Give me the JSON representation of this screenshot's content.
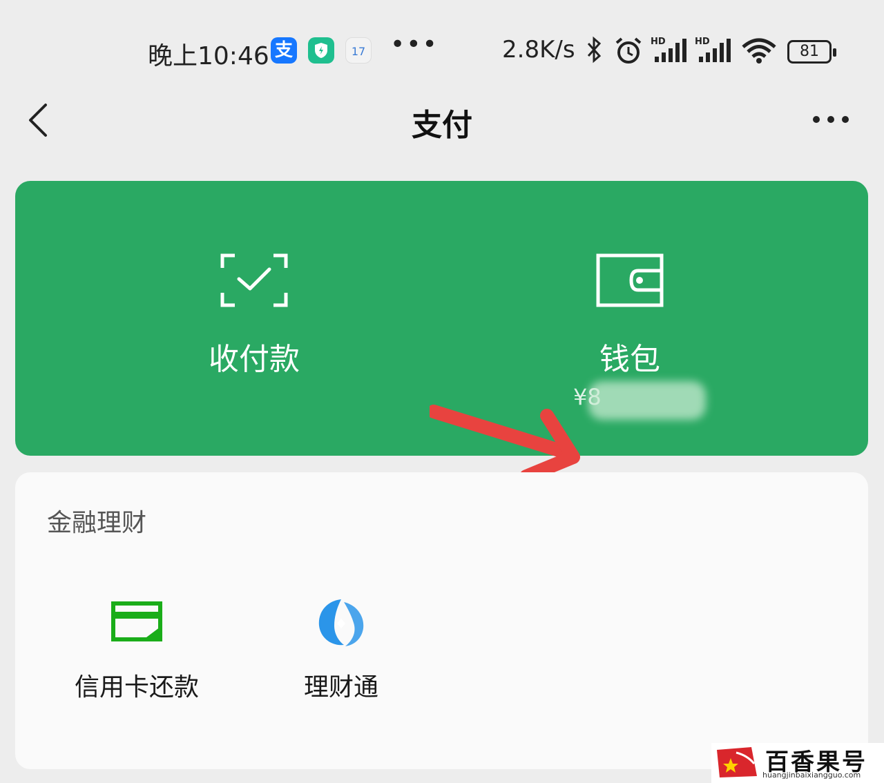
{
  "status_bar": {
    "time": "晚上10:46",
    "alipay_glyph": "支",
    "calendar_day": "17",
    "more_dots": "•••",
    "net_speed": "2.8K/s",
    "battery": "81",
    "icons": [
      "alipay-icon",
      "shield-icon",
      "calendar-icon",
      "bluetooth-icon",
      "alarm-icon",
      "signal-hd-icon",
      "signal-hd-icon",
      "wifi-icon",
      "battery-icon"
    ]
  },
  "nav": {
    "title": "支付",
    "back_icon": "chevron-left-icon",
    "more_icon": "more-dots-icon"
  },
  "green_card": {
    "color": "#2aa963",
    "pay": {
      "label": "收付款",
      "icon": "scan-check-icon"
    },
    "wallet": {
      "label": "钱包",
      "icon": "wallet-icon",
      "balance": "¥8"
    },
    "annotation": "red-arrow"
  },
  "finance": {
    "title": "金融理财",
    "items": [
      {
        "label": "信用卡还款",
        "icon": "credit-card-icon",
        "color": "#1aad19"
      },
      {
        "label": "理财通",
        "icon": "licaitong-icon",
        "color": "#2b95e9"
      }
    ]
  },
  "watermark": {
    "text": "百香果号",
    "url": "huangjinbaixiangguo.com"
  }
}
